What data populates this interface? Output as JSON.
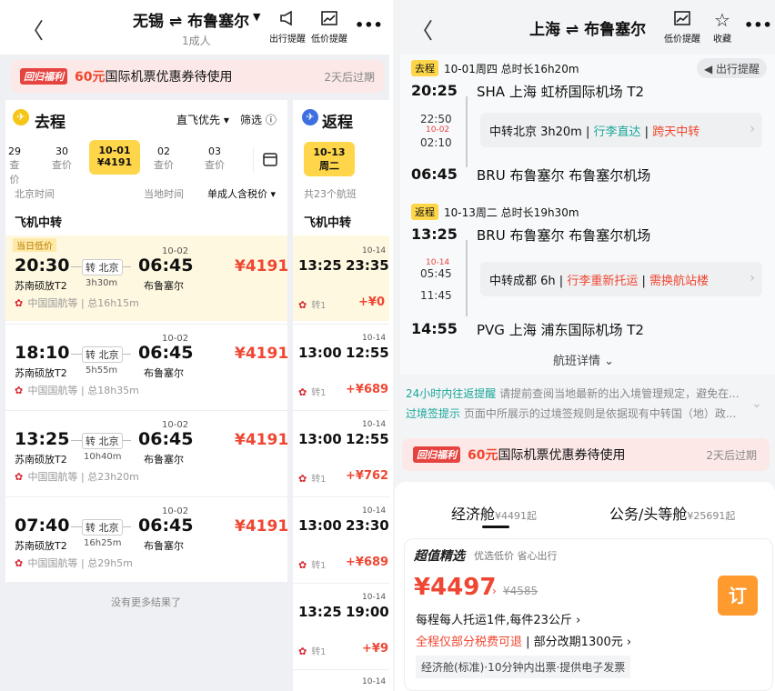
{
  "left": {
    "header": {
      "title": "无锡 ⇌ 布鲁塞尔",
      "subtitle": "1成人",
      "alert_label": "出行提醒",
      "lowprice_label": "低价提醒",
      "more": "•••"
    },
    "promo": {
      "tag": "回归福利",
      "amount": "60元",
      "text": "国际机票优惠券待使用",
      "expire": "2天后过期"
    },
    "outbound": {
      "title": "去程",
      "sort": "直飞优先",
      "filter": "筛选",
      "dates": [
        {
          "date": "29",
          "price": "查价"
        },
        {
          "date": "30",
          "price": "查价"
        },
        {
          "date": "10-01",
          "price": "¥4191"
        },
        {
          "date": "02",
          "price": "查价"
        },
        {
          "date": "03",
          "price": "查价"
        }
      ],
      "col_beijing": "北京时间",
      "col_local": "当地时间",
      "col_price": "单成人含税价",
      "section": "飞机中转",
      "low_tag": "当日低价",
      "flights": [
        {
          "dep": "20:30",
          "dep_ap": "苏南硕放T2",
          "via": "转 北京",
          "dur": "3h30m",
          "arr_date": "10-02",
          "arr": "06:45",
          "arr_ap": "布鲁塞尔",
          "price": "¥4191",
          "airline": "中国国航等",
          "total": "总16h15m"
        },
        {
          "dep": "18:10",
          "dep_ap": "苏南硕放T2",
          "via": "转 北京",
          "dur": "5h55m",
          "arr_date": "10-02",
          "arr": "06:45",
          "arr_ap": "布鲁塞尔",
          "price": "¥4191",
          "airline": "中国国航等",
          "total": "总18h35m"
        },
        {
          "dep": "13:25",
          "dep_ap": "苏南硕放T2",
          "via": "转 北京",
          "dur": "10h40m",
          "arr_date": "10-02",
          "arr": "06:45",
          "arr_ap": "布鲁塞尔",
          "price": "¥4191",
          "airline": "中国国航等",
          "total": "总23h20m"
        },
        {
          "dep": "07:40",
          "dep_ap": "苏南硕放T2",
          "via": "转 北京",
          "dur": "16h25m",
          "arr_date": "10-02",
          "arr": "06:45",
          "arr_ap": "布鲁塞尔",
          "price": "¥4191",
          "airline": "中国国航等",
          "total": "总29h5m"
        }
      ],
      "no_more": "没有更多结果了"
    },
    "return": {
      "title": "返程",
      "date": "10-13",
      "weekday": "周二",
      "count": "共23个航班",
      "section": "飞机中转",
      "flights": [
        {
          "dep": "13:25",
          "arr_date": "10-14",
          "arr": "23:35",
          "stops": "转1",
          "diff": "+¥0"
        },
        {
          "dep": "13:00",
          "arr_date": "10-14",
          "arr": "12:55",
          "stops": "转1",
          "diff": "+¥689"
        },
        {
          "dep": "13:00",
          "arr_date": "10-14",
          "arr": "12:55",
          "stops": "转1",
          "diff": "+¥762"
        },
        {
          "dep": "13:00",
          "arr_date": "10-14",
          "arr": "23:30",
          "stops": "转1",
          "diff": "+¥689"
        },
        {
          "dep": "13:25",
          "arr_date": "10-14",
          "arr": "19:00",
          "stops": "转1",
          "diff": "+¥9"
        },
        {
          "dep": "",
          "arr_date": "10-14",
          "arr": "",
          "stops": "",
          "diff": ""
        }
      ]
    }
  },
  "right": {
    "header": {
      "title": "上海 ⇌ 布鲁塞尔",
      "lowprice_label": "低价提醒",
      "fav_label": "收藏",
      "more": "•••"
    },
    "alert_chip": "出行提醒",
    "out": {
      "tag": "去程",
      "info": "10-01周四 总时长16h20m",
      "dep_time": "20:25",
      "dep": "SHA 上海 虹桥国际机场 T2",
      "transit_arr": "22:50",
      "transit_date": "10-02",
      "transit_dep": "02:10",
      "transit": "中转北京 3h20m",
      "t1": "行李直达",
      "t2": "跨天中转",
      "arr_time": "06:45",
      "arr": "BRU 布鲁塞尔 布鲁塞尔机场"
    },
    "ret": {
      "tag": "返程",
      "info": "10-13周二 总时长19h30m",
      "dep_time": "13:25",
      "dep": "BRU 布鲁塞尔 布鲁塞尔机场",
      "transit_date": "10-14",
      "transit_arr": "05:45",
      "transit_dep": "11:45",
      "transit": "中转成都 6h",
      "t1": "行李重新托运",
      "t2": "需换航站楼",
      "arr_time": "14:55",
      "arr": "PVG 上海 浦东国际机场 T2"
    },
    "details": "航班详情",
    "notice1_title": "24小时内往返提醒",
    "notice1": "请提前查阅当地最新的出入境管理规定，避免在...",
    "notice2_title": "过境签提示",
    "notice2": "页面中所展示的过境签规则是依据现有中转国（地）政...",
    "promo": {
      "tag": "回归福利",
      "amount": "60元",
      "text": "国际机票优惠券待使用",
      "expire": "2天后过期"
    },
    "tabs": [
      {
        "label": "经济舱",
        "price": "¥4491起"
      },
      {
        "label": "公务/头等舱",
        "price": "¥25691起"
      }
    ],
    "offer": {
      "title": "超值精选",
      "sub": "优选低价 省心出行",
      "price": "¥4497",
      "orig": "¥4585",
      "bag": "每程每人托运1件,每件23公斤",
      "refund": "全程仅部分税费可退",
      "change": "部分改期1300元",
      "class_note": "经济舱(标准)·10分钟内出票·提供电子发票",
      "book": "订"
    }
  },
  "colors": {
    "accent": "#ffd64a",
    "price": "#ef4733",
    "orange": "#ff9a2e",
    "link": "#1aa79a"
  }
}
